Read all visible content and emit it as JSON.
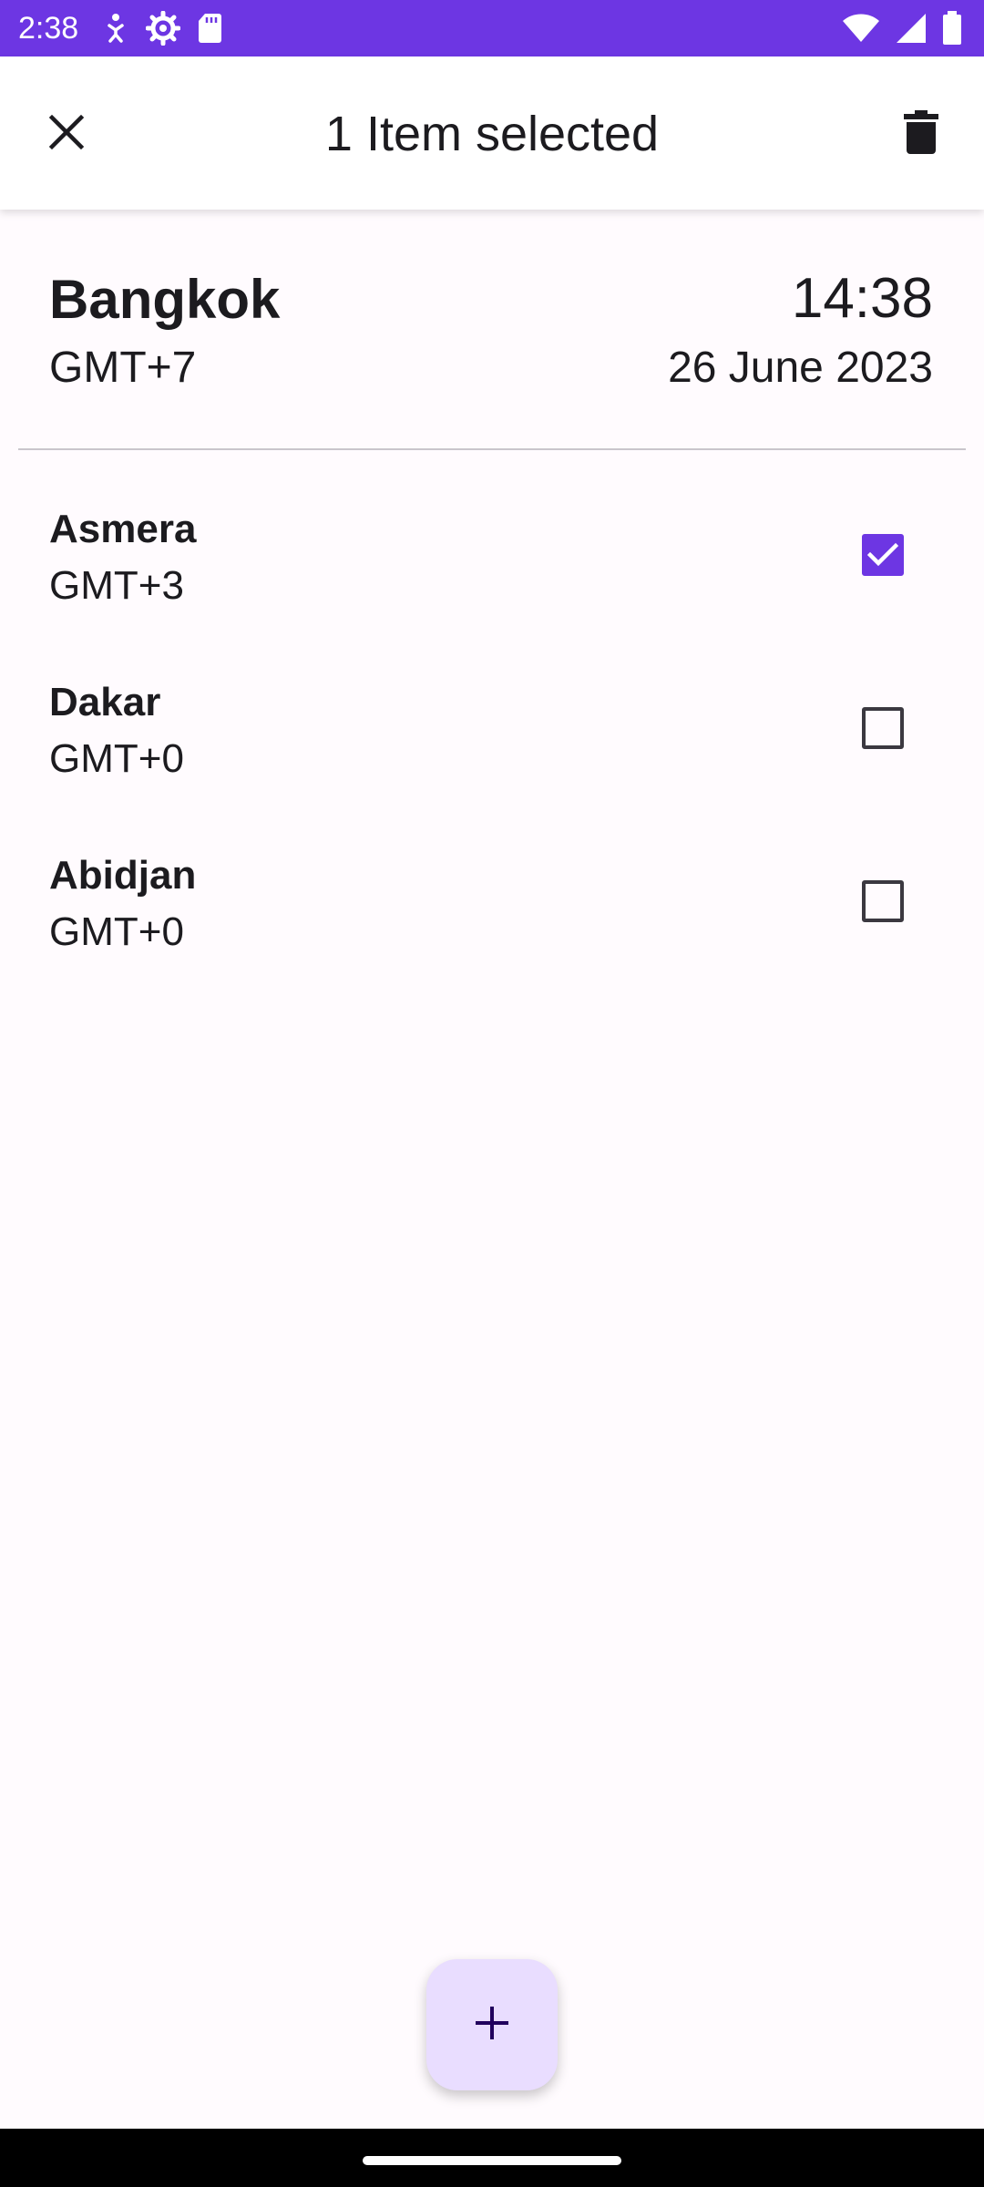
{
  "status_bar": {
    "time": "2:38",
    "left_icons": [
      "accessibility-icon",
      "settings-gear-icon",
      "sd-card-icon"
    ],
    "right_icons": [
      "wifi-icon",
      "cellular-signal-icon",
      "battery-icon"
    ],
    "background_color": "#6d36e3"
  },
  "app_bar": {
    "title": "1 Item selected",
    "close_icon": "close-icon",
    "delete_icon": "trash-icon"
  },
  "home_clock": {
    "city": "Bangkok",
    "timezone": "GMT+7",
    "time": "14:38",
    "date": "26 June 2023"
  },
  "cities": [
    {
      "name": "Asmera",
      "timezone": "GMT+3",
      "checked": true
    },
    {
      "name": "Dakar",
      "timezone": "GMT+0",
      "checked": false
    },
    {
      "name": "Abidjan",
      "timezone": "GMT+0",
      "checked": false
    }
  ],
  "fab": {
    "icon": "plus-icon",
    "background_color": "#e9ddff"
  },
  "colors": {
    "accent": "#6d36e3",
    "background": "#fffbfe"
  }
}
